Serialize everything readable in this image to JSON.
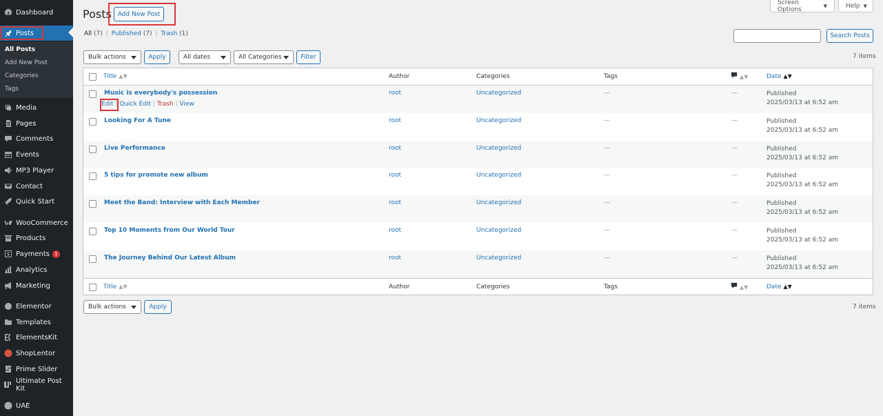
{
  "sidebar": {
    "items": [
      {
        "label": "Dashboard",
        "icon": "dashboard-icon"
      },
      {
        "label": "Posts",
        "icon": "pushpin-icon"
      },
      {
        "label": "Media",
        "icon": "media-icon"
      },
      {
        "label": "Pages",
        "icon": "pages-icon"
      },
      {
        "label": "Comments",
        "icon": "comment-icon"
      },
      {
        "label": "Events",
        "icon": "calendar-icon"
      },
      {
        "label": "MP3 Player",
        "icon": "speaker-icon"
      },
      {
        "label": "Contact",
        "icon": "envelope-icon"
      },
      {
        "label": "Quick Start",
        "icon": "rocket-icon"
      },
      {
        "label": "WooCommerce",
        "icon": "woocommerce-icon"
      },
      {
        "label": "Products",
        "icon": "archive-icon"
      },
      {
        "label": "Payments",
        "icon": "dollar-icon",
        "badge": "1"
      },
      {
        "label": "Analytics",
        "icon": "bar-chart-icon"
      },
      {
        "label": "Marketing",
        "icon": "megaphone-icon"
      },
      {
        "label": "Elementor",
        "icon": "elementor-icon"
      },
      {
        "label": "Templates",
        "icon": "folder-icon"
      },
      {
        "label": "ElementsKit",
        "icon": "elementskit-icon"
      },
      {
        "label": "ShopLentor",
        "icon": "shoplentor-icon"
      },
      {
        "label": "Prime Slider",
        "icon": "prime-slider-icon"
      },
      {
        "label": "Ultimate Post Kit",
        "icon": "upk-icon"
      },
      {
        "label": "UAE",
        "icon": "uae-icon"
      }
    ],
    "submenu": [
      "All Posts",
      "Add New Post",
      "Categories",
      "Tags"
    ]
  },
  "header": {
    "title": "Posts",
    "add_new": "Add New Post",
    "screen_options": "Screen Options",
    "help": "Help"
  },
  "filters": {
    "all": "All",
    "all_count": "(7)",
    "published": "Published",
    "published_count": "(7)",
    "trash": "Trash",
    "trash_count": "(1)",
    "sep": "|"
  },
  "search": {
    "button": "Search Posts",
    "value": ""
  },
  "toolbar": {
    "bulk_actions": "Bulk actions",
    "apply": "Apply",
    "all_dates": "All dates",
    "all_categories": "All Categories",
    "filter": "Filter",
    "items_count": "7 items"
  },
  "table": {
    "headers": {
      "title": "Title",
      "author": "Author",
      "categories": "Categories",
      "tags": "Tags",
      "date": "Date"
    },
    "row_actions": {
      "edit": "Edit",
      "quick_edit": "Quick Edit",
      "trash": "Trash",
      "view": "View",
      "sep": "|"
    },
    "rows": [
      {
        "title": "Music is everybody's possession",
        "author": "root",
        "category": "Uncategorized",
        "tags": "—",
        "comments": "—",
        "status": "Published",
        "date": "2025/03/13 at 6:52 am"
      },
      {
        "title": "Looking For A Tune",
        "author": "root",
        "category": "Uncategorized",
        "tags": "—",
        "comments": "—",
        "status": "Published",
        "date": "2025/03/13 at 6:52 am"
      },
      {
        "title": "Live Performance",
        "author": "root",
        "category": "Uncategorized",
        "tags": "—",
        "comments": "—",
        "status": "Published",
        "date": "2025/03/13 at 6:52 am"
      },
      {
        "title": "5 tips for promote new album",
        "author": "root",
        "category": "Uncategorized",
        "tags": "—",
        "comments": "—",
        "status": "Published",
        "date": "2025/03/13 at 6:52 am"
      },
      {
        "title": "Meet the Band: Interview with Each Member",
        "author": "root",
        "category": "Uncategorized",
        "tags": "—",
        "comments": "—",
        "status": "Published",
        "date": "2025/03/13 at 6:52 am"
      },
      {
        "title": "Top 10 Moments from Our World Tour",
        "author": "root",
        "category": "Uncategorized",
        "tags": "—",
        "comments": "—",
        "status": "Published",
        "date": "2025/03/13 at 6:52 am"
      },
      {
        "title": "The Journey Behind Our Latest Album",
        "author": "root",
        "category": "Uncategorized",
        "tags": "—",
        "comments": "—",
        "status": "Published",
        "date": "2025/03/13 at 6:52 am"
      }
    ]
  },
  "colors": {
    "accent": "#2271b1",
    "sidebar": "#1d2327",
    "highlight": "#d63638"
  }
}
